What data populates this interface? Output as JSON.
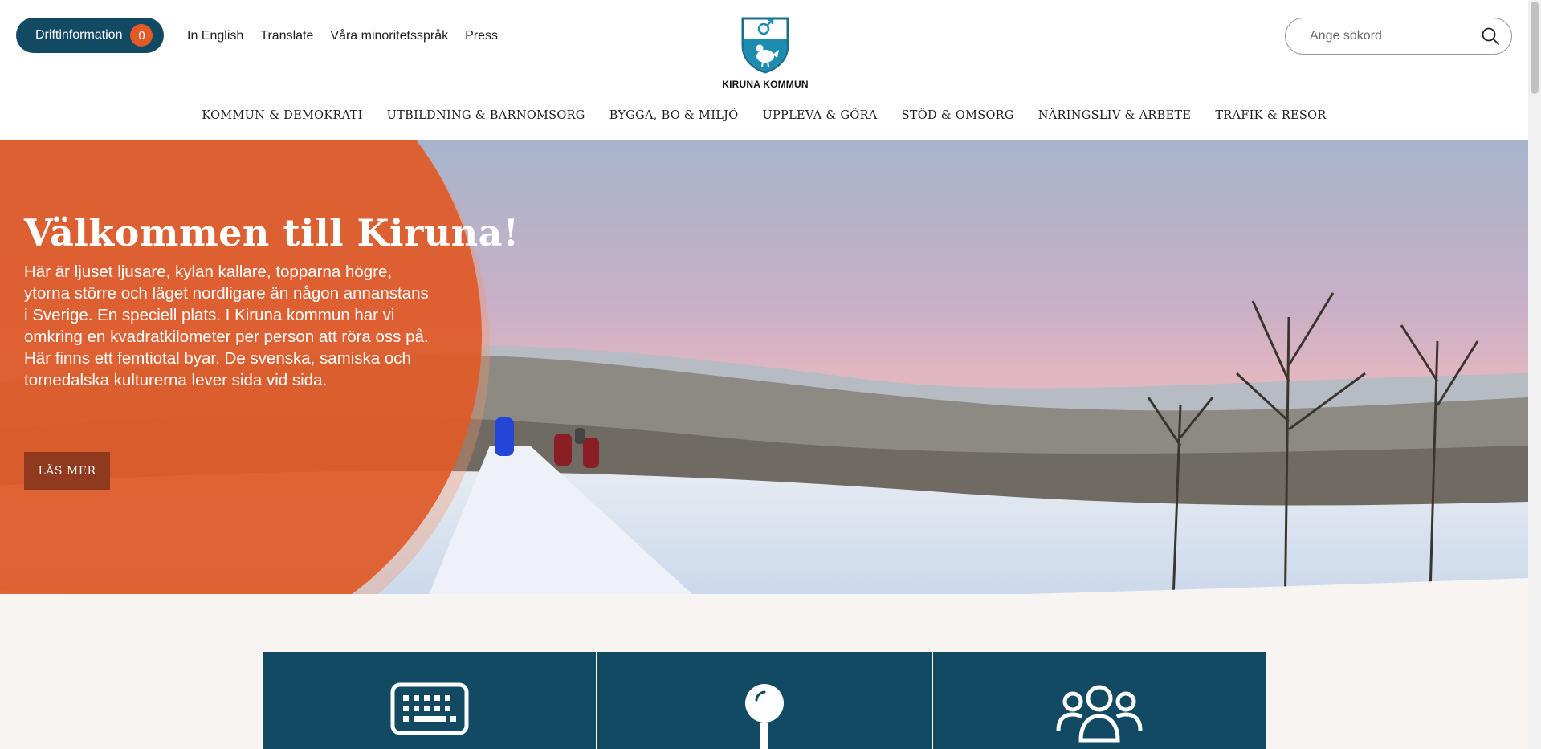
{
  "header": {
    "drift_label": "Driftinformation",
    "drift_count": "0",
    "top_links": [
      "In English",
      "Translate",
      "Våra minoritetsspråk",
      "Press"
    ],
    "logo_text": "KIRUNA KOMMUN",
    "search_placeholder": "Ange sökord"
  },
  "nav": {
    "items": [
      "KOMMUN & DEMOKRATI",
      "UTBILDNING & BARNOMSORG",
      "BYGGA, BO & MILJÖ",
      "UPPLEVA & GÖRA",
      "STÖD & OMSORG",
      "NÄRINGSLIV & ARBETE",
      "TRAFIK & RESOR"
    ]
  },
  "hero": {
    "title": "Välkommen till Kiruna!",
    "text": "Här är ljuset ljusare, kylan kallare, topparna högre, ytorna större och läget nordligare än någon annanstans i Sverige. En speciell plats. I Kiruna kommun har vi omkring en kvadratkilometer per person att röra oss på. Här finns ett femtiotal byar. De svenska, samiska och tornedalska kulturerna lever sida vid sida.",
    "button": "LÄS MER"
  },
  "tiles": [
    {
      "icon": "keyboard-icon"
    },
    {
      "icon": "map-pin-icon"
    },
    {
      "icon": "people-group-icon"
    }
  ],
  "colors": {
    "brand_dark": "#124a63",
    "accent_orange": "#e35a26",
    "button_brown": "#8f3a1e"
  }
}
